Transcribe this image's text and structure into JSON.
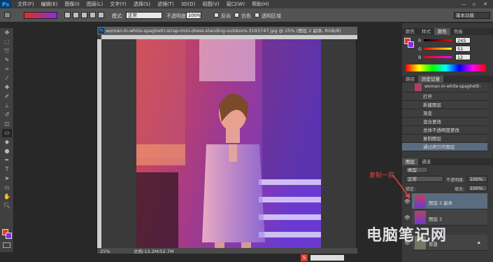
{
  "app": {
    "logo": "Ps"
  },
  "menubar": {
    "items": [
      "文件(F)",
      "编辑(E)",
      "图像(I)",
      "图层(L)",
      "文字(Y)",
      "选择(S)",
      "滤镜(T)",
      "3D(D)",
      "视图(V)",
      "窗口(W)",
      "帮助(H)"
    ]
  },
  "optbar": {
    "mode_label": "模式:",
    "mode_value": "正常",
    "opacity_label": "不透明度:",
    "opacity_value": "100%",
    "reverse_label": "反向",
    "dither_label": "仿色",
    "transparency_label": "透明区域",
    "workspace": "基本功能"
  },
  "document": {
    "title": "woman-in-white-spaghetti-strap-mini-dress-standing-outdoors-3193747.jpg @ 25% (图层 2 副本, RGB/8)",
    "zoom": "25%",
    "size": "文档:13.2M/52.7M"
  },
  "color_panel": {
    "tabs": [
      "颜色",
      "样式",
      "颜色",
      "色板"
    ],
    "r": "245",
    "g": "51",
    "b": "12",
    "r_label": "R",
    "g_label": "G",
    "b_label": "B"
  },
  "history_panel": {
    "tabs": [
      "路径",
      "历史记录"
    ],
    "snapshot": "woman-in-white-spaghetti-strap...",
    "items": [
      "打开",
      "新建图层",
      "渐变",
      "混合更改",
      "总体不透明度更改",
      "复制图层",
      "通过拷贝的图层"
    ]
  },
  "layers_panel": {
    "tabs": [
      "图层",
      "通道"
    ],
    "kind": "类型",
    "blend": "正常",
    "opacity_label": "不透明度:",
    "opacity_value": "100%",
    "lock_label": "锁定:",
    "fill_label": "填充:",
    "fill_value": "100%",
    "layers": [
      {
        "name": "图层 2 副本"
      },
      {
        "name": "图层 2"
      },
      {
        "name": "背景"
      }
    ]
  },
  "annotation": {
    "text": "复制一层"
  },
  "watermark": {
    "text": "电脑笔记网"
  },
  "colors": {
    "foreground": "#f53316",
    "background": "#8a2be2"
  }
}
